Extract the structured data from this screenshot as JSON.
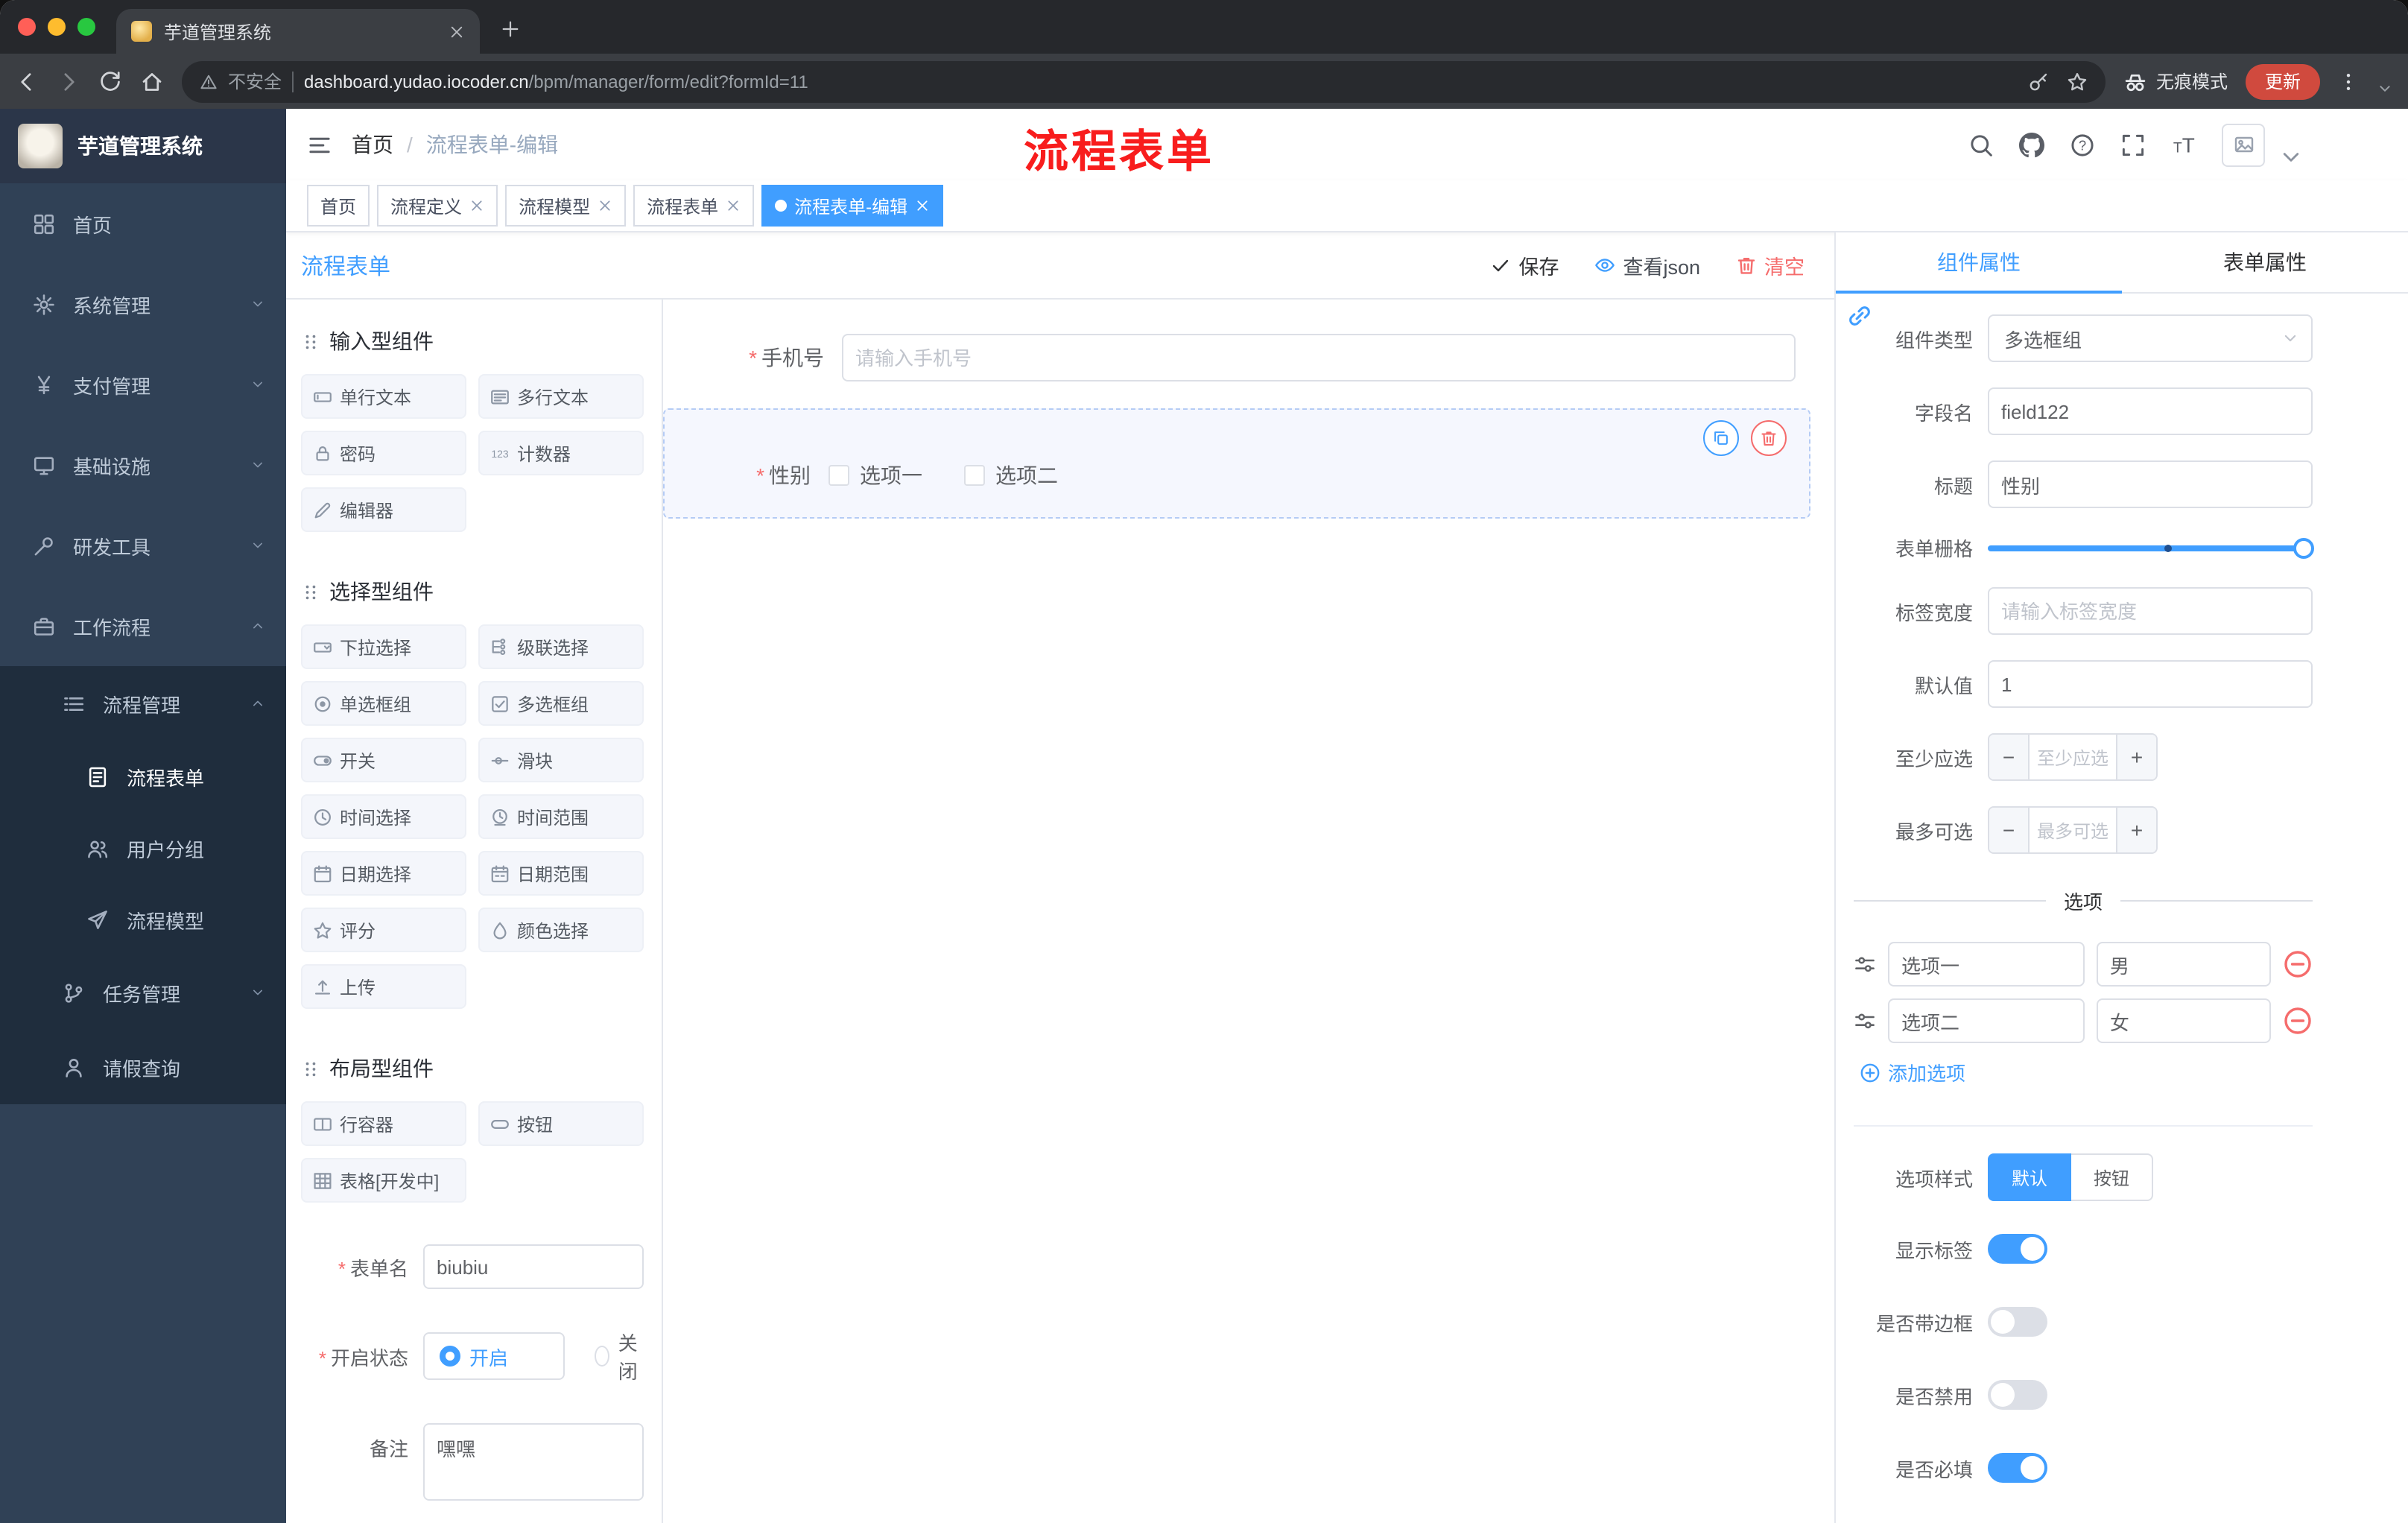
{
  "browser": {
    "tab_title": "芋道管理系统",
    "security_label": "不安全",
    "url_domain": "dashboard.yudao.iocoder.cn",
    "url_path": "/bpm/manager/form/edit?formId=11",
    "incognito_label": "无痕模式",
    "update_label": "更新"
  },
  "sidebar": {
    "logo_title": "芋道管理系统",
    "menu": [
      {
        "key": "home",
        "label": "首页",
        "icon": "dashboard-icon"
      },
      {
        "key": "system-management",
        "label": "系统管理",
        "icon": "gear-icon",
        "chevron": "down"
      },
      {
        "key": "payment-management",
        "label": "支付管理",
        "icon": "yen-icon",
        "chevron": "down"
      },
      {
        "key": "infrastructure",
        "label": "基础设施",
        "icon": "monitor-icon",
        "chevron": "down"
      },
      {
        "key": "dev-tools",
        "label": "研发工具",
        "icon": "tool-icon",
        "chevron": "down"
      },
      {
        "key": "workflow",
        "label": "工作流程",
        "icon": "briefcase-icon",
        "chevron": "up"
      }
    ],
    "submenu": {
      "process_mgmt": {
        "key": "process-management",
        "label": "流程管理",
        "icon": "list-icon",
        "chevron": "up"
      },
      "process_children": [
        {
          "key": "process-form",
          "label": "流程表单",
          "icon": "form-icon",
          "active": true
        },
        {
          "key": "user-group",
          "label": "用户分组",
          "icon": "people-icon"
        },
        {
          "key": "process-model",
          "label": "流程模型",
          "icon": "send-icon"
        }
      ],
      "task_mgmt": {
        "key": "task-management",
        "label": "任务管理",
        "icon": "branch-icon",
        "chevron": "down"
      },
      "leave_query": {
        "key": "leave-query",
        "label": "请假查询",
        "icon": "person-icon"
      }
    }
  },
  "header": {
    "breadcrumb": [
      "首页",
      "流程表单-编辑"
    ],
    "annotation": "流程表单"
  },
  "tags": [
    {
      "key": "home",
      "label": "首页",
      "closable": false,
      "active": false
    },
    {
      "key": "process-definition",
      "label": "流程定义",
      "closable": true,
      "active": false
    },
    {
      "key": "process-model",
      "label": "流程模型",
      "closable": true,
      "active": false
    },
    {
      "key": "process-form",
      "label": "流程表单",
      "closable": true,
      "active": false
    },
    {
      "key": "process-form-edit",
      "label": "流程表单-编辑",
      "closable": true,
      "active": true
    }
  ],
  "designer": {
    "title": "流程表单",
    "actions": [
      {
        "key": "save",
        "label": "保存",
        "icon": "check-icon"
      },
      {
        "key": "view-json",
        "label": "查看json",
        "icon": "eye-icon"
      },
      {
        "key": "clear",
        "label": "清空",
        "icon": "trash-icon"
      }
    ],
    "palette": [
      {
        "title": "输入型组件",
        "items": [
          {
            "key": "input",
            "label": "单行文本",
            "icon": "input-icon"
          },
          {
            "key": "textarea",
            "label": "多行文本",
            "icon": "textarea-icon"
          },
          {
            "key": "password",
            "label": "密码",
            "icon": "password-icon"
          },
          {
            "key": "counter",
            "label": "计数器",
            "icon": "counter-icon"
          },
          {
            "key": "editor",
            "label": "编辑器",
            "icon": "editor-icon"
          }
        ]
      },
      {
        "title": "选择型组件",
        "items": [
          {
            "key": "select",
            "label": "下拉选择",
            "icon": "select-icon"
          },
          {
            "key": "cascader",
            "label": "级联选择",
            "icon": "cascader-icon"
          },
          {
            "key": "radio-group",
            "label": "单选框组",
            "icon": "radio-icon"
          },
          {
            "key": "checkbox-group",
            "label": "多选框组",
            "icon": "checkbox-icon"
          },
          {
            "key": "switch",
            "label": "开关",
            "icon": "switch-icon"
          },
          {
            "key": "slider",
            "label": "滑块",
            "icon": "slider-icon"
          },
          {
            "key": "time-picker",
            "label": "时间选择",
            "icon": "time-icon"
          },
          {
            "key": "time-range",
            "label": "时间范围",
            "icon": "time-range-icon"
          },
          {
            "key": "date-picker",
            "label": "日期选择",
            "icon": "date-icon"
          },
          {
            "key": "date-range",
            "label": "日期范围",
            "icon": "date-range-icon"
          },
          {
            "key": "rate",
            "label": "评分",
            "icon": "rate-icon"
          },
          {
            "key": "color-picker",
            "label": "颜色选择",
            "icon": "color-icon"
          },
          {
            "key": "upload",
            "label": "上传",
            "icon": "upload-icon"
          }
        ]
      },
      {
        "title": "布局型组件",
        "items": [
          {
            "key": "row-container",
            "label": "行容器",
            "icon": "row-icon"
          },
          {
            "key": "button",
            "label": "按钮",
            "icon": "button-icon"
          },
          {
            "key": "table",
            "label": "表格[开发中]",
            "icon": "table-icon"
          }
        ]
      }
    ],
    "form_config": {
      "form_name_label": "表单名",
      "form_name_value": "biubiu",
      "status_label": "开启状态",
      "status_on": "开启",
      "status_off": "关闭",
      "remark_label": "备注",
      "remark_value": "嘿嘿"
    },
    "canvas": {
      "phone": {
        "label": "手机号",
        "required": true,
        "placeholder": "请输入手机号"
      },
      "gender": {
        "label": "性别",
        "required": true,
        "options": [
          "选项一",
          "选项二"
        ]
      }
    }
  },
  "props_panel": {
    "tabs": [
      "组件属性",
      "表单属性"
    ],
    "active_tab": "组件属性",
    "component_type_label": "组件类型",
    "component_type_value": "多选框组",
    "field_name_label": "字段名",
    "field_name_value": "field122",
    "title_label": "标题",
    "title_value": "性别",
    "grid_label": "表单栅格",
    "label_width_label": "标签宽度",
    "label_width_placeholder": "请输入标签宽度",
    "default_label": "默认值",
    "default_value": "1",
    "min_label": "至少应选",
    "min_placeholder": "至少应选",
    "max_label": "最多可选",
    "max_placeholder": "最多可选",
    "options_divider": "选项",
    "options": [
      {
        "name": "选项一",
        "value": "男"
      },
      {
        "name": "选项二",
        "value": "女"
      }
    ],
    "add_option_label": "添加选项",
    "option_style_label": "选项样式",
    "option_style_buttons": [
      "默认",
      "按钮"
    ],
    "option_style_active": "默认",
    "toggles": [
      {
        "key": "show-label",
        "label": "显示标签",
        "on": true
      },
      {
        "key": "with-border",
        "label": "是否带边框",
        "on": false
      },
      {
        "key": "disabled",
        "label": "是否禁用",
        "on": false
      },
      {
        "key": "required",
        "label": "是否必填",
        "on": true
      }
    ]
  },
  "colors": {
    "accent": "#409eff",
    "danger": "#f56c6c",
    "annotation": "#f81d1d",
    "sidebar_bg": "#304156"
  }
}
